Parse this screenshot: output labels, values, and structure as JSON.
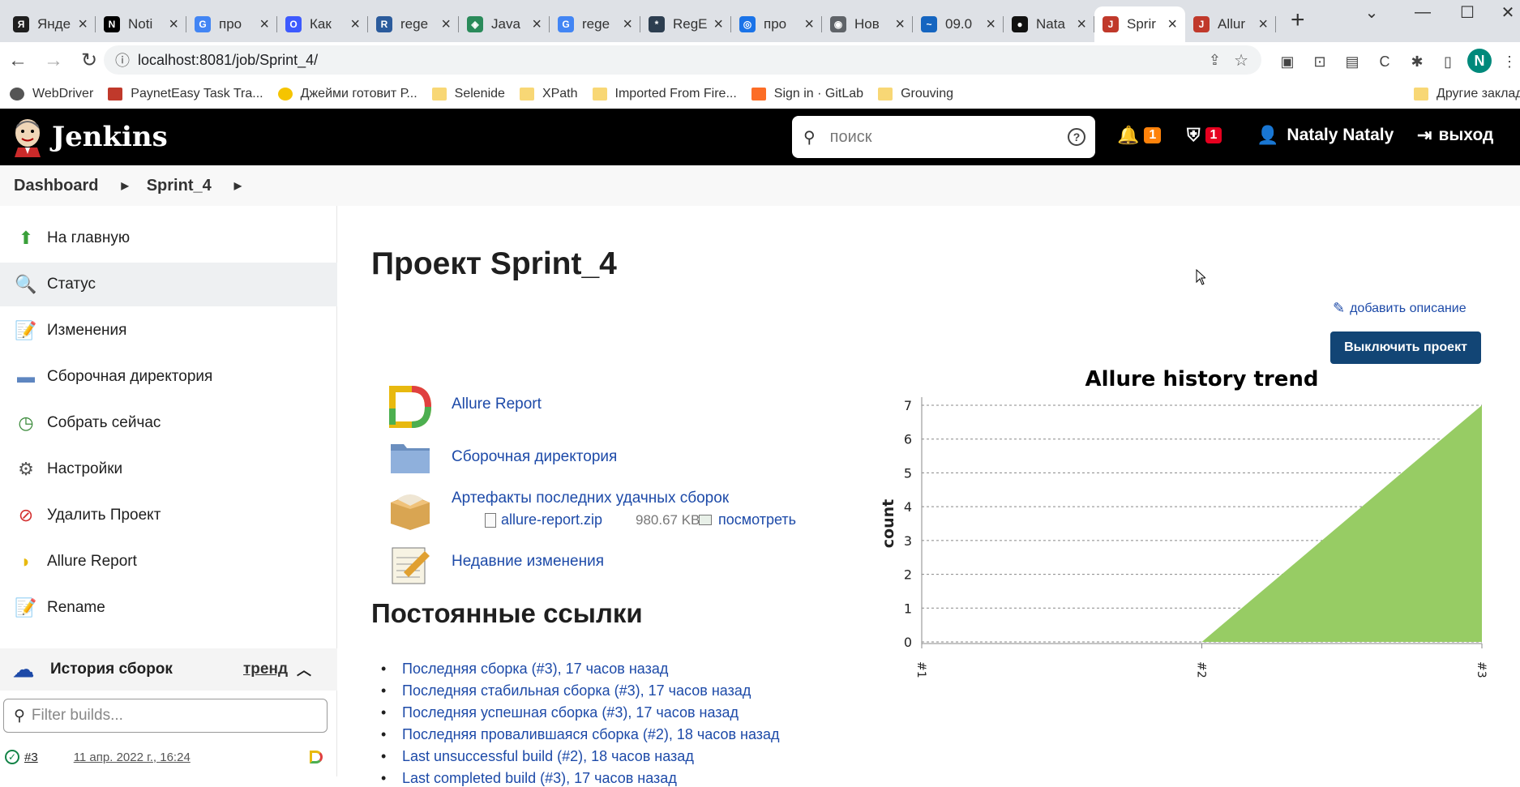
{
  "browser": {
    "tabs": [
      {
        "title": "Янде",
        "icon": "yandex-icon",
        "color": "#1f1f1f",
        "glyph": "Я"
      },
      {
        "title": "Noti",
        "icon": "notion-icon",
        "color": "#000000",
        "glyph": "N"
      },
      {
        "title": "про",
        "icon": "google-icon",
        "color": "#4285f4",
        "glyph": "G"
      },
      {
        "title": "Как",
        "icon": "blue-o-icon",
        "color": "#3d5afe",
        "glyph": "O"
      },
      {
        "title": "rege",
        "icon": "r-icon",
        "color": "#2b5b9c",
        "glyph": "R"
      },
      {
        "title": "Java",
        "icon": "diamond-icon",
        "color": "#2a8a5a",
        "glyph": "◈"
      },
      {
        "title": "rege",
        "icon": "google-icon",
        "color": "#4285f4",
        "glyph": "G"
      },
      {
        "title": "RegE",
        "icon": "regexr-icon",
        "color": "#2d3e50",
        "glyph": "*"
      },
      {
        "title": "про",
        "icon": "circle-icon",
        "color": "#1a73e8",
        "glyph": "◎"
      },
      {
        "title": "Нов",
        "icon": "chrome-icon",
        "color": "#5f6368",
        "glyph": "◉"
      },
      {
        "title": "09.0",
        "icon": "wave-icon",
        "color": "#1565c0",
        "glyph": "~"
      },
      {
        "title": "Nata",
        "icon": "github-icon",
        "color": "#111111",
        "glyph": "●"
      },
      {
        "title": "Sprir",
        "icon": "jenkins-icon",
        "color": "#c0392b",
        "glyph": "J",
        "active": true
      },
      {
        "title": "Allur",
        "icon": "jenkins-icon",
        "color": "#c0392b",
        "glyph": "J"
      }
    ],
    "url": "localhost:8081/job/Sprint_4/",
    "bookmarks": [
      {
        "label": "WebDriver",
        "type": "globe"
      },
      {
        "label": "PaynetEasy Task Tra...",
        "type": "paynet"
      },
      {
        "label": "Джейми готовит Р...",
        "type": "yellow"
      },
      {
        "label": "Selenide",
        "type": "folder"
      },
      {
        "label": "XPath",
        "type": "folder"
      },
      {
        "label": "Imported From Fire...",
        "type": "folder"
      },
      {
        "label": "Sign in · GitLab",
        "type": "gitlab"
      },
      {
        "label": "Grouving",
        "type": "folder"
      }
    ],
    "other_bookmarks": "Другие закладки",
    "profile_initial": "N"
  },
  "header": {
    "app_name": "Jenkins",
    "search_placeholder": "поиск",
    "notifications_count": "1",
    "security_count": "1",
    "user_name": "Nataly Nataly",
    "logout_label": "выход"
  },
  "breadcrumbs": [
    "Dashboard",
    "Sprint_4"
  ],
  "sidebar": {
    "tasks": [
      {
        "label": "На главную",
        "icon": "up-arrow-icon"
      },
      {
        "label": "Статус",
        "icon": "magnifier-icon",
        "selected": true
      },
      {
        "label": "Изменения",
        "icon": "notepad-icon"
      },
      {
        "label": "Сборочная директория",
        "icon": "folder-icon"
      },
      {
        "label": "Собрать сейчас",
        "icon": "clock-play-icon"
      },
      {
        "label": "Настройки",
        "icon": "gear-icon"
      },
      {
        "label": "Удалить Проект",
        "icon": "no-entry-icon"
      },
      {
        "label": "Allure Report",
        "icon": "allure-icon"
      },
      {
        "label": "Rename",
        "icon": "notepad-icon"
      }
    ],
    "history": {
      "title": "История сборок",
      "trend_label": "тренд",
      "filter_placeholder": "Filter builds...",
      "builds": [
        {
          "number": "#3",
          "date": "11 апр. 2022 г., 16:24"
        }
      ]
    }
  },
  "main": {
    "title": "Проект Sprint_4",
    "add_description": "добавить описание",
    "disable_button": "Выключить проект",
    "links": {
      "allure": "Allure Report",
      "workspace": "Сборочная директория",
      "artifacts": "Артефакты последних удачных сборок",
      "artifact_file": "allure-report.zip",
      "artifact_size": "980.67 KB",
      "artifact_view": "посмотреть",
      "changes": "Недавние изменения"
    },
    "permalinks_title": "Постоянные ссылки",
    "permalinks": [
      "Последняя сборка (#3), 17 часов назад",
      "Последняя стабильная сборка (#3), 17 часов назад",
      "Последняя успешная сборка (#3), 17 часов назад",
      "Последняя провалившаяся сборка (#2), 18 часов назад",
      "Last unsuccessful build (#2), 18 часов назад",
      "Last completed build (#3), 17 часов назад"
    ]
  },
  "chart_data": {
    "type": "area",
    "title": "Allure history trend",
    "ylabel": "count",
    "xlabel": "",
    "categories": [
      "#1",
      "#2",
      "#3"
    ],
    "series": [
      {
        "values": [
          0,
          0,
          7
        ],
        "color": "#97cc64"
      }
    ],
    "ylim": [
      0,
      7
    ],
    "yticks": [
      0,
      1,
      2,
      3,
      4,
      5,
      6,
      7
    ],
    "grid": true
  }
}
